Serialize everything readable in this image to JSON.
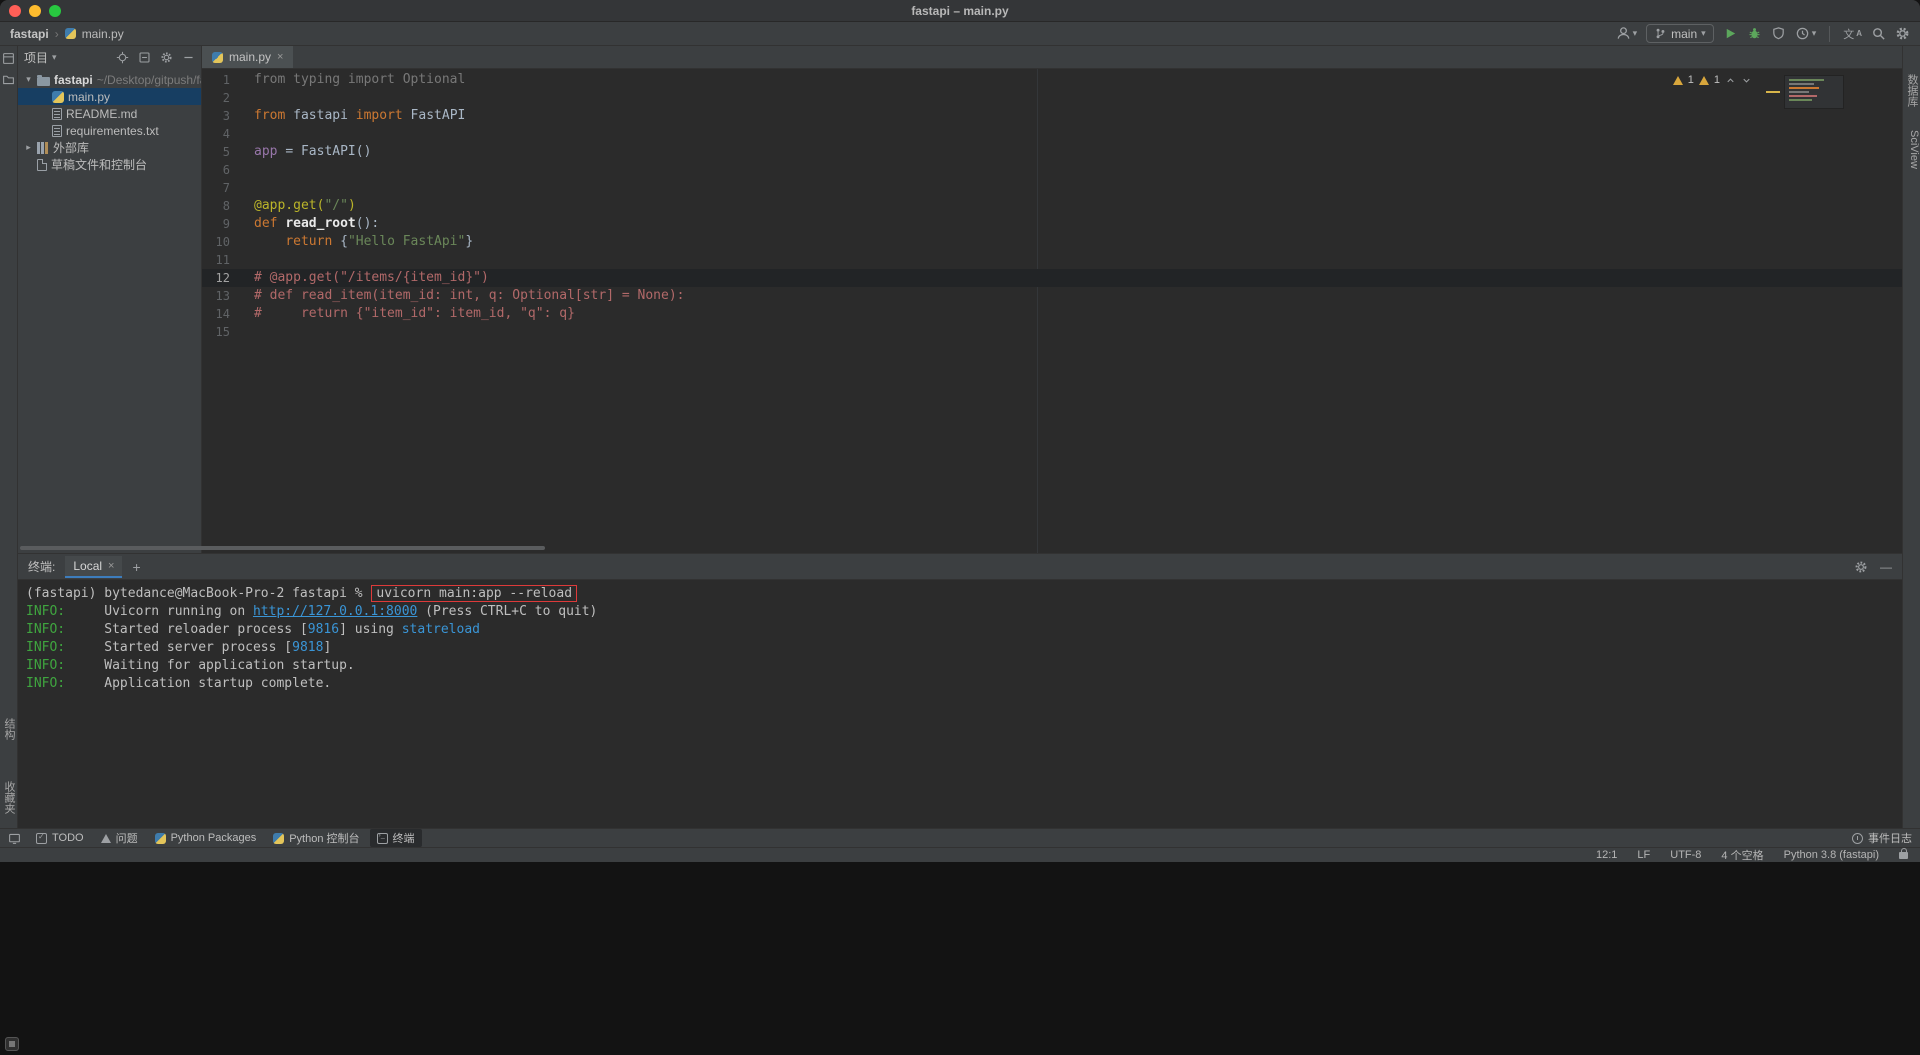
{
  "window": {
    "title": "fastapi – main.py"
  },
  "navbar": {
    "breadcrumbs": [
      "fastapi",
      "main.py"
    ],
    "branch": "main"
  },
  "stripes": {
    "left_bottom": [
      "结构",
      "收藏夹"
    ],
    "right": [
      "数据库",
      "SciView"
    ]
  },
  "project": {
    "title": "项目",
    "items": [
      {
        "name": "fastapi",
        "hint": "~/Desktop/gitpush/fas",
        "icon": "folder",
        "level": 0,
        "expanded": true,
        "bold": true
      },
      {
        "name": "main.py",
        "icon": "python",
        "level": 1,
        "selected": true
      },
      {
        "name": "README.md",
        "icon": "md",
        "level": 1
      },
      {
        "name": "requirementes.txt",
        "icon": "txt",
        "level": 1
      },
      {
        "name": "外部库",
        "icon": "lib",
        "level": 0,
        "collapsed": true
      },
      {
        "name": "草稿文件和控制台",
        "icon": "scratch",
        "level": 0
      }
    ]
  },
  "editor": {
    "tab": "main.py",
    "inspection": {
      "warning1": "1",
      "warning2": "1"
    },
    "lines": [
      {
        "n": 1,
        "tokens": [
          [
            "from typing import Optional",
            "unused"
          ]
        ]
      },
      {
        "n": 2,
        "tokens": []
      },
      {
        "n": 3,
        "tokens": [
          [
            "from",
            "kw"
          ],
          [
            " fastapi ",
            "plain"
          ],
          [
            "import",
            "kw"
          ],
          [
            " FastAPI",
            "plain"
          ]
        ]
      },
      {
        "n": 4,
        "tokens": []
      },
      {
        "n": 5,
        "tokens": [
          [
            "app ",
            "var"
          ],
          [
            "= ",
            "plain"
          ],
          [
            "FastAPI()",
            "plain"
          ]
        ]
      },
      {
        "n": 6,
        "tokens": []
      },
      {
        "n": 7,
        "tokens": []
      },
      {
        "n": 8,
        "tokens": [
          [
            "@app.get(",
            "deco"
          ],
          [
            "\"/\"",
            "str"
          ],
          [
            ")",
            "deco"
          ]
        ]
      },
      {
        "n": 9,
        "tokens": [
          [
            "def ",
            "kw"
          ],
          [
            "read_root",
            "fn"
          ],
          [
            "():",
            "plain"
          ]
        ]
      },
      {
        "n": 10,
        "tokens": [
          [
            "    ",
            "plain"
          ],
          [
            "return ",
            "kw"
          ],
          [
            "{",
            "plain"
          ],
          [
            "\"Hello FastApi\"",
            "str"
          ],
          [
            "}",
            "plain"
          ]
        ]
      },
      {
        "n": 11,
        "tokens": []
      },
      {
        "n": 12,
        "active": true,
        "tokens": [
          [
            "# @app.get(\"/items/{item_id}\")",
            "comment"
          ]
        ]
      },
      {
        "n": 13,
        "tokens": [
          [
            "# def read_item(item_id: int, q: Optional[str] = None):",
            "comment"
          ]
        ]
      },
      {
        "n": 14,
        "tokens": [
          [
            "#     return {\"item_id\": item_id, \"q\": q}",
            "comment"
          ]
        ]
      },
      {
        "n": 15,
        "tokens": []
      }
    ]
  },
  "terminal": {
    "label": "终端:",
    "tab": "Local",
    "lines": [
      {
        "tokens": [
          [
            "(fastapi) bytedance@MacBook-Pro-2 fastapi % ",
            "plain"
          ],
          [
            "uvicorn main:app --reload",
            "boxed"
          ]
        ]
      },
      {
        "tokens": [
          [
            "INFO:",
            "info"
          ],
          [
            "     Uvicorn running on ",
            "plain"
          ],
          [
            "http://127.0.0.1:8000",
            "link"
          ],
          [
            " (Press CTRL+C to quit)",
            "plain"
          ]
        ]
      },
      {
        "tokens": [
          [
            "INFO:",
            "info"
          ],
          [
            "     Started reloader process [",
            "plain"
          ],
          [
            "9816",
            "cyan"
          ],
          [
            "] using ",
            "plain"
          ],
          [
            "statreload",
            "cyan"
          ]
        ]
      },
      {
        "tokens": [
          [
            "INFO:",
            "info"
          ],
          [
            "     Started server process [",
            "plain"
          ],
          [
            "9818",
            "cyan"
          ],
          [
            "]",
            "plain"
          ]
        ]
      },
      {
        "tokens": [
          [
            "INFO:",
            "info"
          ],
          [
            "     Waiting for application startup.",
            "plain"
          ]
        ]
      },
      {
        "tokens": [
          [
            "INFO:",
            "info"
          ],
          [
            "     Application startup complete.",
            "plain"
          ]
        ]
      }
    ]
  },
  "toolbar_bottom": {
    "items": [
      {
        "label": "TODO",
        "icon": "todo"
      },
      {
        "label": "问题",
        "icon": "problems"
      },
      {
        "label": "Python Packages",
        "icon": "python"
      },
      {
        "label": "Python 控制台",
        "icon": "python"
      },
      {
        "label": "终端",
        "icon": "terminal",
        "active": true
      }
    ],
    "event_log": "事件日志"
  },
  "status_bar": {
    "items": [
      "12:1",
      "LF",
      "UTF-8",
      "4 个空格",
      "Python 3.8 (fastapi)"
    ]
  },
  "icons": {
    "close-icon": "×",
    "add-icon": "+",
    "dropdown-icon": "▾",
    "chevron-separator": "›",
    "minimize-icon": "—",
    "translate-icon-main": "文",
    "translate-icon-sub": "A",
    "search-icon": "magnifier",
    "settings-icon": "gear",
    "run-icon": "play-triangle",
    "debug-icon": "bug",
    "coverage-icon": "shield",
    "profiler-icon": "clock",
    "user-icon": "person",
    "branch-icon": "git-branch",
    "locate-icon": "crosshair",
    "collapse-icon": "collapse-box"
  },
  "colors": {
    "kw": "#cc7832",
    "str": "#6a8759",
    "deco": "#bbb529",
    "fn": "#e9e9e9",
    "var": "#9876aa",
    "plain": "#a9b7c6",
    "unused": "#787878",
    "comment": "#b26969",
    "info": "#3fa53f",
    "term": "#bfbfbf",
    "cyan": "#3a95d6",
    "red": "#dd3a3a",
    "selection": "#173e62",
    "accent_green": "#5ca75c",
    "warning_yellow": "#d8a63c"
  }
}
